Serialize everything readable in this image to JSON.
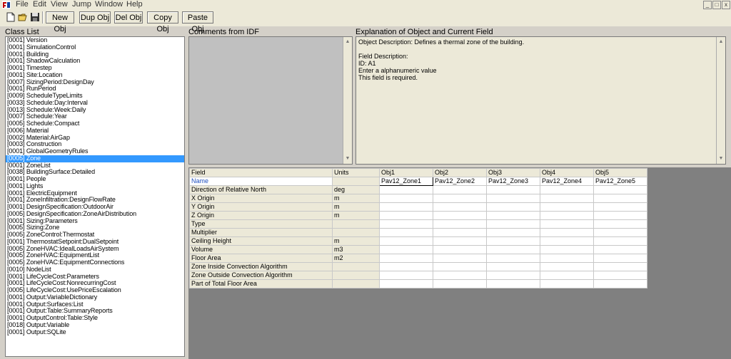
{
  "menu": {
    "items": [
      "File",
      "Edit",
      "View",
      "Jump",
      "Window",
      "Help"
    ]
  },
  "window_controls": {
    "minimize": "_",
    "restore": "□",
    "close": "x"
  },
  "toolbar": {
    "new_obj": "New Obj",
    "dup_obj": "Dup Obj",
    "del_obj": "Del Obj",
    "copy_obj": "Copy Obj",
    "paste_obj": "Paste Obj"
  },
  "panels": {
    "class_list_label": "Class List",
    "comments_label": "Comments from IDF",
    "explanation_label": "Explanation of Object and Current Field"
  },
  "class_list": {
    "selected_index": 17,
    "items": [
      "[0001]  Version",
      "[0001]  SimulationControl",
      "[0001]  Building",
      "[0001]  ShadowCalculation",
      "[0001]  Timestep",
      "[0001]  Site:Location",
      "[0007]  SizingPeriod:DesignDay",
      "[0001]  RunPeriod",
      "[0009]  ScheduleTypeLimits",
      "[0033]  Schedule:Day:Interval",
      "[0013]  Schedule:Week:Daily",
      "[0007]  Schedule:Year",
      "[0005]  Schedule:Compact",
      "[0006]  Material",
      "[0002]  Material:AirGap",
      "[0003]  Construction",
      "[0001]  GlobalGeometryRules",
      "[0005]  Zone",
      "[0001]  ZoneList",
      "[0038]  BuildingSurface:Detailed",
      "[0001]  People",
      "[0001]  Lights",
      "[0001]  ElectricEquipment",
      "[0001]  ZoneInfiltration:DesignFlowRate",
      "[0001]  DesignSpecification:OutdoorAir",
      "[0005]  DesignSpecification:ZoneAirDistribution",
      "[0001]  Sizing:Parameters",
      "[0005]  Sizing:Zone",
      "[0005]  ZoneControl:Thermostat",
      "[0001]  ThermostatSetpoint:DualSetpoint",
      "[0005]  ZoneHVAC:IdealLoadsAirSystem",
      "[0005]  ZoneHVAC:EquipmentList",
      "[0005]  ZoneHVAC:EquipmentConnections",
      "[0010]  NodeList",
      "[0001]  LifeCycleCost:Parameters",
      "[0001]  LifeCycleCost:NonrecurringCost",
      "[0005]  LifeCycleCost:UsePriceEscalation",
      "[0001]  Output:VariableDictionary",
      "[0001]  Output:Surfaces:List",
      "[0001]  Output:Table:SummaryReports",
      "[0001]  OutputControl:Table:Style",
      "[0018]  Output:Variable",
      "[0001]  Output:SQLite"
    ]
  },
  "explanation": {
    "text": "Object Description: Defines a thermal zone of the building.\n\nField Description:\nID: A1\nEnter a alphanumeric value\nThis field is required."
  },
  "grid": {
    "headers": [
      "Field",
      "Units",
      "Obj1",
      "Obj2",
      "Obj3",
      "Obj4",
      "Obj5"
    ],
    "rows": [
      {
        "field": "Name",
        "units": "",
        "values": [
          "Pav12_Zone1",
          "Pav12_Zone2",
          "Pav12_Zone3",
          "Pav12_Zone4",
          "Pav12_Zone5"
        ]
      },
      {
        "field": "Direction of Relative North",
        "units": "deg",
        "values": [
          "",
          "",
          "",
          "",
          ""
        ]
      },
      {
        "field": "X Origin",
        "units": "m",
        "values": [
          "",
          "",
          "",
          "",
          ""
        ]
      },
      {
        "field": "Y Origin",
        "units": "m",
        "values": [
          "",
          "",
          "",
          "",
          ""
        ]
      },
      {
        "field": "Z Origin",
        "units": "m",
        "values": [
          "",
          "",
          "",
          "",
          ""
        ]
      },
      {
        "field": "Type",
        "units": "",
        "values": [
          "",
          "",
          "",
          "",
          ""
        ]
      },
      {
        "field": "Multiplier",
        "units": "",
        "values": [
          "",
          "",
          "",
          "",
          ""
        ]
      },
      {
        "field": "Ceiling Height",
        "units": "m",
        "values": [
          "",
          "",
          "",
          "",
          ""
        ]
      },
      {
        "field": "Volume",
        "units": "m3",
        "values": [
          "",
          "",
          "",
          "",
          ""
        ]
      },
      {
        "field": "Floor Area",
        "units": "m2",
        "values": [
          "",
          "",
          "",
          "",
          ""
        ]
      },
      {
        "field": "Zone Inside Convection Algorithm",
        "units": "",
        "values": [
          "",
          "",
          "",
          "",
          ""
        ]
      },
      {
        "field": "Zone Outside Convection Algorithm",
        "units": "",
        "values": [
          "",
          "",
          "",
          "",
          ""
        ]
      },
      {
        "field": "Part of Total Floor Area",
        "units": "",
        "values": [
          "",
          "",
          "",
          "",
          ""
        ]
      }
    ]
  }
}
